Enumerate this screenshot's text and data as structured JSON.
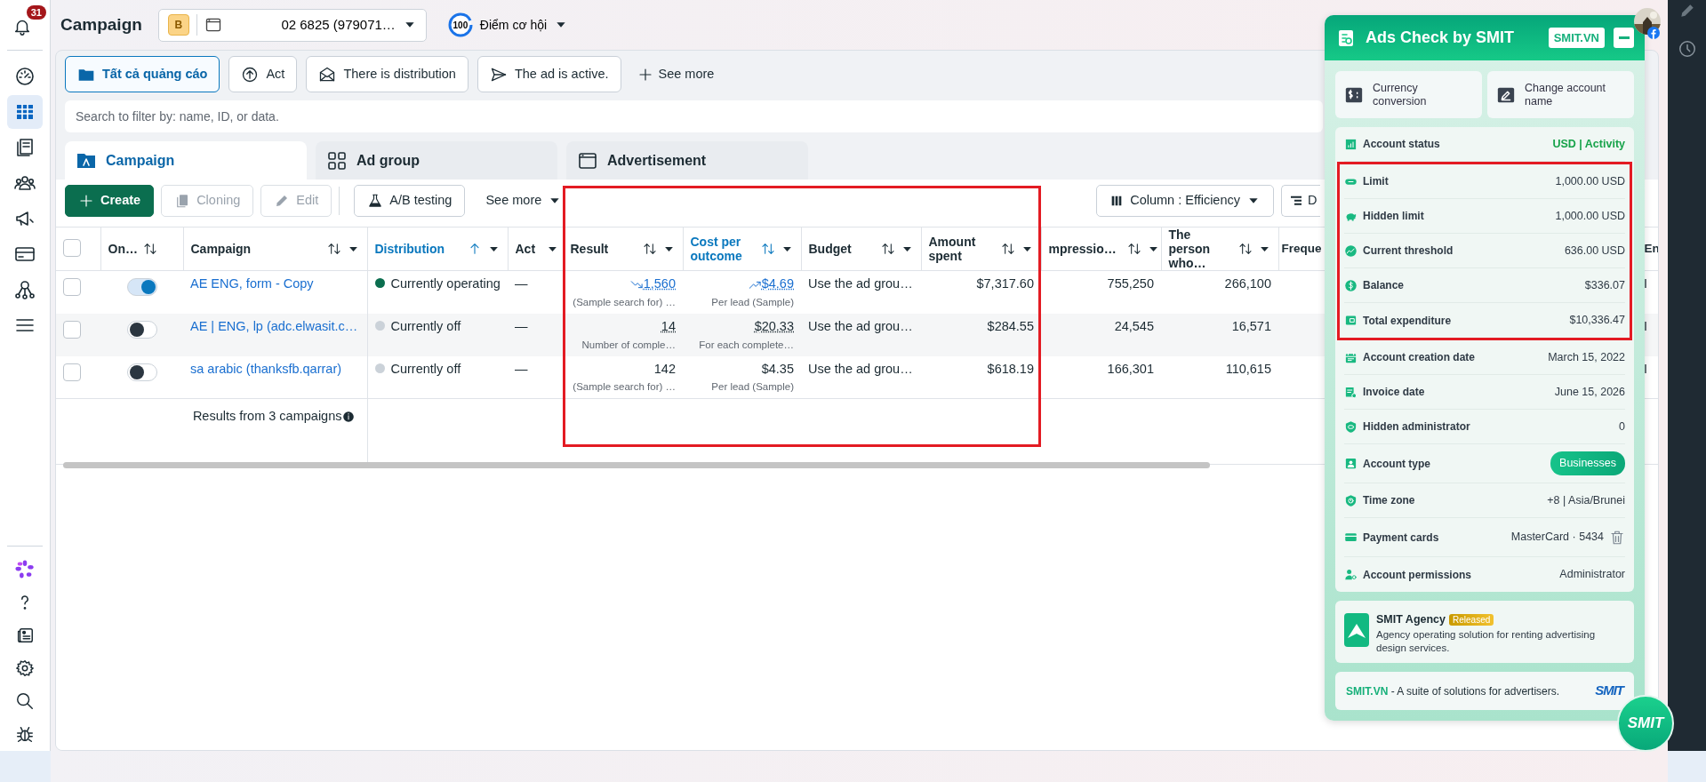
{
  "sidebar": {
    "notification_count": "31",
    "items": [
      {
        "selected": false
      },
      {
        "selected": true
      },
      {
        "selected": false
      },
      {
        "selected": false
      },
      {
        "selected": false
      },
      {
        "selected": false
      },
      {
        "selected": false
      },
      {
        "selected": false
      }
    ],
    "bottom_items": [
      {
        "selected": false
      },
      {
        "selected": false
      },
      {
        "selected": false
      },
      {
        "selected": false
      },
      {
        "selected": false
      },
      {
        "selected": false
      }
    ]
  },
  "header": {
    "title": "Campaign",
    "account": {
      "badge": "B",
      "name": "02 6825 (979071…"
    },
    "score": {
      "value": "100",
      "label": "Điểm cơ hội"
    }
  },
  "filters": {
    "chips": [
      {
        "label": "Tất cả quảng cáo",
        "selected": true
      },
      {
        "label": "Act",
        "selected": false
      },
      {
        "label": "There is distribution",
        "selected": false
      },
      {
        "label": "The ad is active.",
        "selected": false
      }
    ],
    "more": "See more"
  },
  "search": {
    "placeholder": "Search to filter by: name, ID, or data."
  },
  "level_tabs": [
    {
      "label": "Campaign",
      "selected": true
    },
    {
      "label": "Ad group",
      "selected": false
    },
    {
      "label": "Advertisement",
      "selected": false
    }
  ],
  "toolbar": {
    "left": [
      {
        "label": "Create",
        "kind": "primary",
        "disabled": false
      },
      {
        "label": "Cloning",
        "kind": "outline",
        "disabled": true
      },
      {
        "label": "Edit",
        "kind": "outline",
        "disabled": true
      },
      {
        "label": "A/B testing",
        "kind": "outline",
        "disabled": false
      },
      {
        "label": "See more",
        "kind": "menu",
        "disabled": false
      }
    ],
    "right": [
      {
        "label": "Column : Efficiency",
        "kind": "menu"
      },
      {
        "label": "D",
        "kind": "plain"
      }
    ]
  },
  "table": {
    "header_checked": false,
    "columns": [
      {
        "label": "On…",
        "sortable": true,
        "sorted": false,
        "active": false
      },
      {
        "label": "Campaign",
        "sortable": true,
        "sorted": false,
        "menu": true,
        "active": false
      },
      {
        "label": "Distribution",
        "sortable": true,
        "sorted": true,
        "menu": true,
        "active": true
      },
      {
        "label": "Act",
        "menu": true,
        "active": false
      },
      {
        "label": "Result",
        "sortable": true,
        "sorted": false,
        "menu": true,
        "active": false,
        "highlighted": true
      },
      {
        "label": "Cost per outcome",
        "sortable": true,
        "sorted": false,
        "menu": true,
        "active": true,
        "highlighted": true
      },
      {
        "label": "Budget",
        "sortable": true,
        "sorted": false,
        "menu": true,
        "active": false,
        "highlighted": true
      },
      {
        "label": "Amount spent",
        "sortable": true,
        "sorted": false,
        "menu": true,
        "active": false,
        "highlighted": true
      },
      {
        "label": "mpressio…",
        "sortable": true,
        "sorted": false,
        "menu": true,
        "active": false
      },
      {
        "label": "The person who…",
        "sortable": true,
        "sorted": false,
        "menu": true,
        "active": false
      },
      {
        "label": "Freque",
        "active": false
      },
      {
        "label": "En",
        "active": false
      }
    ],
    "rows": [
      {
        "selected": false,
        "on": true,
        "campaign": "AE ENG, form - Copy",
        "status": "Currently operating",
        "color": "#0b6e4f",
        "act": "—",
        "result": {
          "value": "1,560",
          "note": "(Sample search for) …",
          "kind": "link",
          "trend_icon": true,
          "rising": false
        },
        "cost": {
          "value": "$4.69",
          "note": "Per lead (Sample)",
          "kind": "link",
          "trend_icon": true,
          "rising": true
        },
        "budget": "Use the ad grou…",
        "spent": "$7,317.60",
        "impressions": "755,250",
        "reach": "266,100",
        "column_12": "I"
      },
      {
        "selected": false,
        "on": false,
        "campaign": "AE | ENG, lp (adc.elwasit.c…",
        "status": "Currently off",
        "color": "#cbd2d9",
        "act": "—",
        "result": {
          "value": "14",
          "note": "Number of comple…",
          "kind": "dotted"
        },
        "cost": {
          "value": "$20.33",
          "note": "For each complete…",
          "kind": "dotted"
        },
        "budget": "Use the ad grou…",
        "spent": "$284.55",
        "impressions": "24,545",
        "reach": "16,571",
        "column_12": "I"
      },
      {
        "selected": false,
        "on": false,
        "campaign": "sa arabic (thanksfb.qarrar)",
        "status": "Currently off",
        "color": "#cbd2d9",
        "act": "—",
        "result": {
          "value": "142",
          "note": "(Sample search for) …",
          "kind": "plain"
        },
        "cost": {
          "value": "$4.35",
          "note": "Per lead (Sample)",
          "kind": "plain"
        },
        "budget": "Use the ad grou…",
        "spent": "$618.19",
        "impressions": "166,301",
        "reach": "110,615",
        "column_12": "I"
      }
    ],
    "footer": "Results from 3 campaigns"
  },
  "panel": {
    "title": "Ads Check by SMIT",
    "site_button": "SMIT.VN",
    "actions": [
      {
        "label": "Currency conversion"
      },
      {
        "label": "Change account name"
      }
    ],
    "rows": [
      {
        "label": "Account status",
        "value": "USD | Activity",
        "kind": "status"
      },
      {
        "label": "Limit",
        "value": "1,000.00 USD",
        "kind": "text",
        "highlighted": true
      },
      {
        "label": "Hidden limit",
        "value": "1,000.00 USD",
        "kind": "text",
        "highlighted": true
      },
      {
        "label": "Current threshold",
        "value": "636.00 USD",
        "kind": "text",
        "highlighted": true
      },
      {
        "label": "Balance",
        "value": "$336.07",
        "kind": "text",
        "highlighted": true
      },
      {
        "label": "Total expenditure",
        "value": "$10,336.47",
        "kind": "text",
        "highlighted": true
      },
      {
        "label": "Account creation date",
        "value": "March 15, 2022",
        "kind": "text"
      },
      {
        "label": "Invoice date",
        "value": "June 15, 2026",
        "kind": "text"
      },
      {
        "label": "Hidden administrator",
        "value": "0",
        "kind": "text"
      },
      {
        "label": "Account type",
        "value": "Businesses",
        "kind": "badge"
      },
      {
        "label": "Time zone",
        "value": "+8 | Asia/Brunei",
        "kind": "text"
      },
      {
        "label": "Payment cards",
        "value": "MasterCard · 5434",
        "kind": "card"
      },
      {
        "label": "Account permissions",
        "value": "Administrator",
        "kind": "text"
      }
    ],
    "agency": {
      "name": "SMIT Agency",
      "badge": "Released",
      "text": "Agency operating solution for renting advertising design services."
    },
    "footer": {
      "brand": "SMIT.VN",
      "text": " - A suite of solutions for advertisers.",
      "logo": "SMIT"
    }
  },
  "launcher": "SMIT"
}
